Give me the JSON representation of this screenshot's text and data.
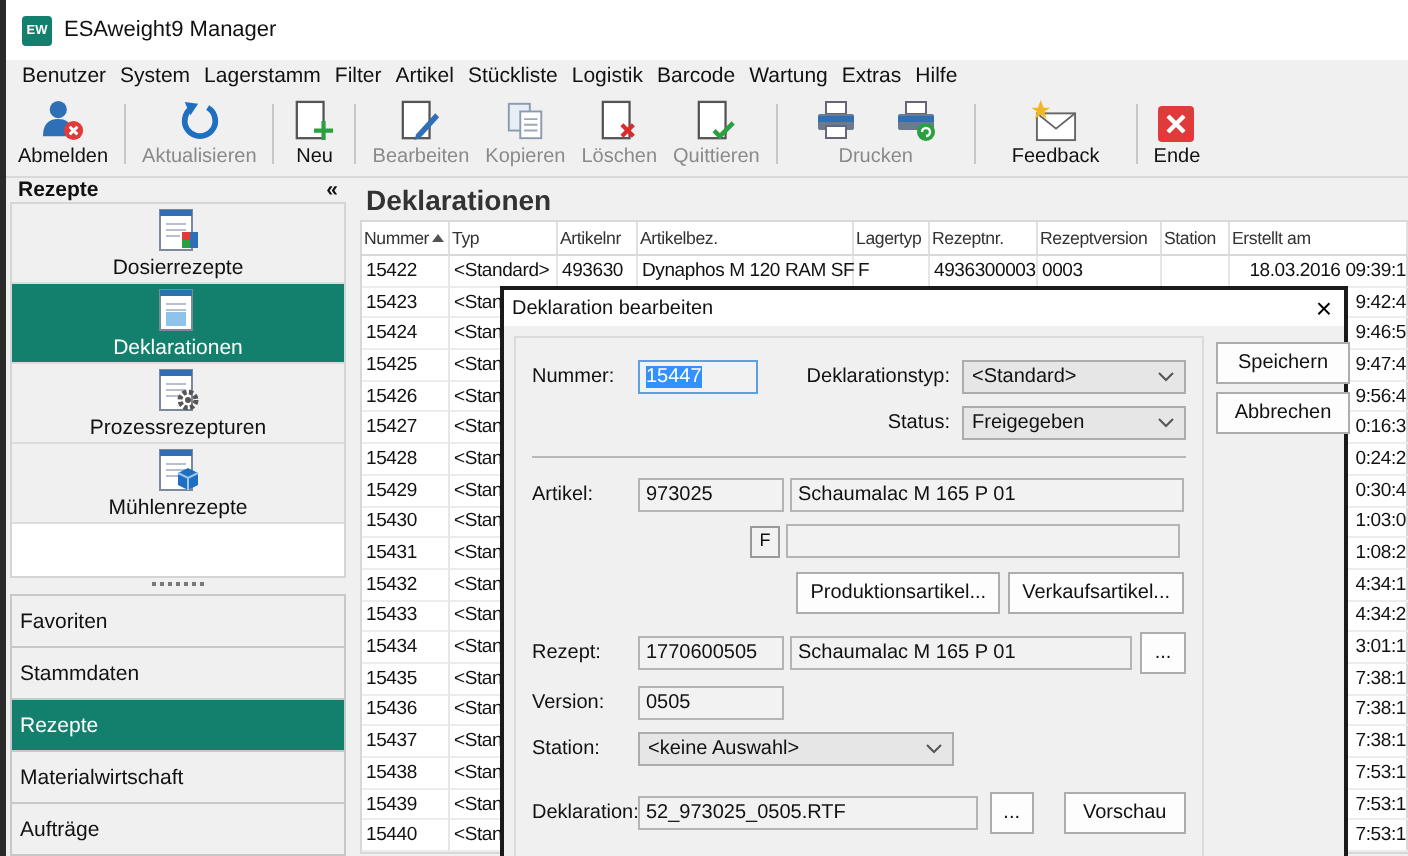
{
  "window": {
    "title": "ESAweight9 Manager",
    "logo": "EW"
  },
  "menu": [
    "Benutzer",
    "System",
    "Lagerstamm",
    "Filter",
    "Artikel",
    "Stückliste",
    "Logistik",
    "Barcode",
    "Wartung",
    "Extras",
    "Hilfe"
  ],
  "toolbar": {
    "groups": [
      {
        "buttons": [
          {
            "label": "Abmelden",
            "kind": "logout",
            "disabled": false
          }
        ]
      },
      {
        "buttons": [
          {
            "label": "Aktualisieren",
            "kind": "refresh",
            "disabled": true
          }
        ]
      },
      {
        "buttons": [
          {
            "label": "Neu",
            "kind": "new",
            "disabled": false
          }
        ]
      },
      {
        "buttons": [
          {
            "label": "Bearbeiten",
            "kind": "edit",
            "disabled": true
          },
          {
            "label": "Kopieren",
            "kind": "copy",
            "disabled": true
          },
          {
            "label": "Löschen",
            "kind": "delete",
            "disabled": true
          },
          {
            "label": "Quittieren",
            "kind": "confirm",
            "disabled": true
          }
        ]
      },
      {
        "buttons": [
          {
            "label": "Drucken",
            "kind": "print",
            "disabled": true
          }
        ]
      },
      {
        "buttons": [
          {
            "label": "Feedback",
            "kind": "feedback",
            "disabled": false
          }
        ]
      },
      {
        "buttons": [
          {
            "label": "Ende",
            "kind": "exit",
            "disabled": false
          }
        ]
      }
    ]
  },
  "sidebar": {
    "title": "Rezepte",
    "collapse": "«",
    "items": [
      {
        "label": "Dosierrezepte",
        "kind": "dosing",
        "selected": false
      },
      {
        "label": "Deklarationen",
        "kind": "declaration",
        "selected": true
      },
      {
        "label": "Prozessrezepturen",
        "kind": "process",
        "selected": false
      },
      {
        "label": "Mühlenrezepte",
        "kind": "mill",
        "selected": false
      }
    ],
    "sections": [
      {
        "label": "Favoriten",
        "selected": false
      },
      {
        "label": "Stammdaten",
        "selected": false
      },
      {
        "label": "Rezepte",
        "selected": true
      },
      {
        "label": "Materialwirtschaft",
        "selected": false
      },
      {
        "label": "Aufträge",
        "selected": false
      }
    ]
  },
  "grid": {
    "title": "Deklarationen",
    "columns": [
      {
        "label": "Nummer",
        "sorted": true
      },
      {
        "label": "Typ",
        "sorted": false
      },
      {
        "label": "Artikelnr",
        "sorted": false
      },
      {
        "label": "Artikelbez.",
        "sorted": false
      },
      {
        "label": "Lagertyp",
        "sorted": false
      },
      {
        "label": "Rezeptnr.",
        "sorted": false
      },
      {
        "label": "Rezeptversion",
        "sorted": false
      },
      {
        "label": "Station",
        "sorted": false
      },
      {
        "label": "Erstellt am",
        "sorted": false
      }
    ],
    "rows": [
      {
        "nummer": "15422",
        "typ": "<Standard>",
        "artikelnr": "493630",
        "artikelbez": "Dynaphos M 120 RAM SF",
        "lagertyp": "F",
        "rezeptnr": "4936300003",
        "rezeptversion": "0003",
        "erstellt_am": "18.03.2016 09:39:1"
      },
      {
        "nummer": "15423",
        "typ": "<Stan",
        "erstellt_am": "9:42:4"
      },
      {
        "nummer": "15424",
        "typ": "<Stan",
        "erstellt_am": "9:46:5"
      },
      {
        "nummer": "15425",
        "typ": "<Stan",
        "erstellt_am": "9:47:4"
      },
      {
        "nummer": "15426",
        "typ": "<Stan",
        "erstellt_am": "9:56:4"
      },
      {
        "nummer": "15427",
        "typ": "<Stan",
        "erstellt_am": "0:16:3"
      },
      {
        "nummer": "15428",
        "typ": "<Stan",
        "erstellt_am": "0:24:2"
      },
      {
        "nummer": "15429",
        "typ": "<Stan",
        "erstellt_am": "0:30:4"
      },
      {
        "nummer": "15430",
        "typ": "<Stan",
        "erstellt_am": "1:03:0"
      },
      {
        "nummer": "15431",
        "typ": "<Stan",
        "erstellt_am": "1:08:2"
      },
      {
        "nummer": "15432",
        "typ": "<Stan",
        "erstellt_am": "4:34:1"
      },
      {
        "nummer": "15433",
        "typ": "<Stan",
        "erstellt_am": "4:34:2"
      },
      {
        "nummer": "15434",
        "typ": "<Stan",
        "erstellt_am": "3:01:1"
      },
      {
        "nummer": "15435",
        "typ": "<Stan",
        "erstellt_am": "7:38:1"
      },
      {
        "nummer": "15436",
        "typ": "<Stan",
        "erstellt_am": "7:38:1"
      },
      {
        "nummer": "15437",
        "typ": "<Stan",
        "erstellt_am": "7:38:1"
      },
      {
        "nummer": "15438",
        "typ": "<Stan",
        "erstellt_am": "7:53:1"
      },
      {
        "nummer": "15439",
        "typ": "<Stan",
        "erstellt_am": "7:53:1"
      },
      {
        "nummer": "15440",
        "typ": "<Stan",
        "erstellt_am": "7:53:1"
      }
    ]
  },
  "dialog": {
    "title": "Deklaration bearbeiten",
    "close": "×",
    "buttons": [
      {
        "label": "Speichern"
      },
      {
        "label": "Abbrechen"
      }
    ],
    "nummer": {
      "label": "Nummer:",
      "value": "15447",
      "text_selected": true
    },
    "deklarationstyp": {
      "label": "Deklarationstyp:",
      "value": "<Standard>"
    },
    "status": {
      "label": "Status:",
      "value": "Freigegeben"
    },
    "artikel": {
      "label": "Artikel:",
      "number": "973025",
      "name": "Schaumalac M 165 P 01",
      "lagertyp": "F"
    },
    "artikel_buttons": [
      "Produktionsartikel...",
      "Verkaufsartikel..."
    ],
    "rezept": {
      "label": "Rezept:",
      "number": "1770600505",
      "name": "Schaumalac M 165 P 01",
      "browse": "..."
    },
    "version": {
      "label": "Version:",
      "value": "0505"
    },
    "station": {
      "label": "Station:",
      "value": "<keine Auswahl>"
    },
    "deklaration": {
      "label": "Deklaration:",
      "value": "52_973025_0505.RTF",
      "browse": "...",
      "preview": "Vorschau"
    }
  }
}
